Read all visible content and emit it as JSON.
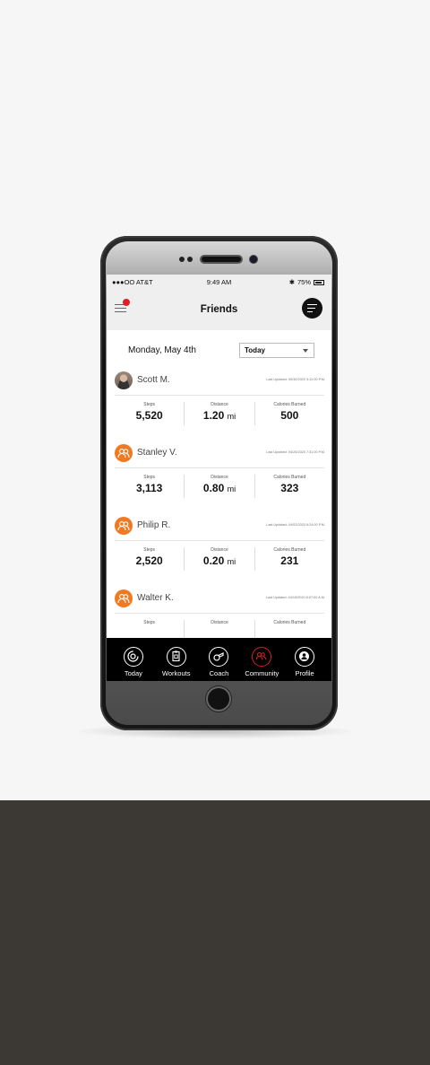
{
  "status_bar": {
    "carrier": "●●●OO AT&T",
    "time": "9:49 AM",
    "battery": "75%"
  },
  "header": {
    "title": "Friends"
  },
  "filter": {
    "date": "Monday, May 4th",
    "period": "Today"
  },
  "friends": [
    {
      "name": "Scott M.",
      "updated": "Last Updated: 05/30/2020 3:12:00 P.M.",
      "steps_label": "Steps",
      "steps": "5,520",
      "distance_label": "Distance",
      "distance": "1.20",
      "distance_unit": "mi",
      "calories_label": "Calories Burned",
      "calories": "500"
    },
    {
      "name": "Stanley V.",
      "updated": "Last Updated: 04/25/2020 7:31:00 P.M.",
      "steps_label": "Steps",
      "steps": "3,113",
      "distance_label": "Distance",
      "distance": "0.80",
      "distance_unit": "mi",
      "calories_label": "Calories Burned",
      "calories": "323"
    },
    {
      "name": "Philip R.",
      "updated": "Last Updated: 04/02/2020 6:24:00 P.M.",
      "steps_label": "Steps",
      "steps": "2,520",
      "distance_label": "Distance",
      "distance": "0.20",
      "distance_unit": "mi",
      "calories_label": "Calories Burned",
      "calories": "231"
    },
    {
      "name": "Walter K.",
      "updated": "Last Updated: 04/15/2020 8:07:00 A.M.",
      "steps_label": "Steps",
      "steps": "",
      "distance_label": "Distance",
      "distance": "",
      "distance_unit": "",
      "calories_label": "Calories Burned",
      "calories": ""
    }
  ],
  "tabs": [
    {
      "label": "Today",
      "icon": "rings-icon"
    },
    {
      "label": "Workouts",
      "icon": "clipboard-icon"
    },
    {
      "label": "Coach",
      "icon": "whistle-icon"
    },
    {
      "label": "Community",
      "icon": "people-icon"
    },
    {
      "label": "Profile",
      "icon": "user-icon"
    }
  ],
  "colors": {
    "accent": "#f07a24",
    "notification": "#e31b23",
    "tabbar": "#000000",
    "header": "#efefef"
  }
}
